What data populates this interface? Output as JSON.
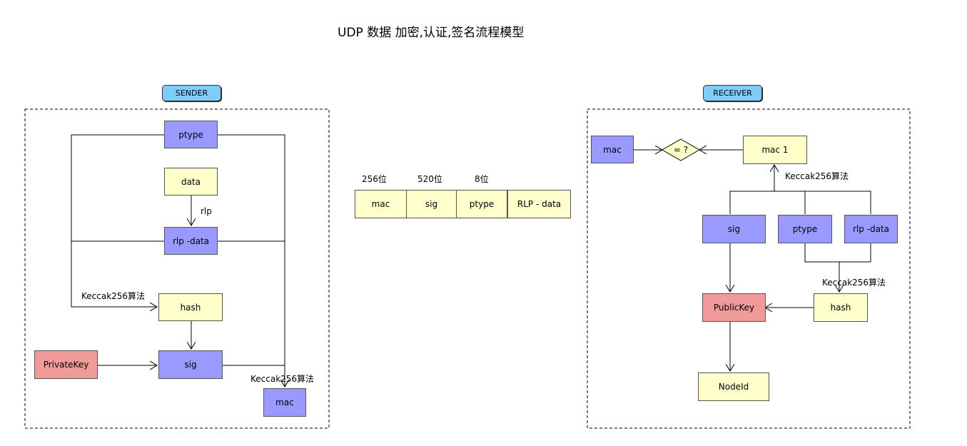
{
  "title": "UDP 数据 加密,认证,签名流程模型",
  "sender": {
    "label": "SENDER",
    "ptype": "ptype",
    "data": "data",
    "rlp_label": "rlp",
    "rlp_data": "rlp -data",
    "keccak_label": "Keccak256算法",
    "hash": "hash",
    "private_key": "PrivateKey",
    "sig": "sig",
    "keccak_label_2": "Keccak256算法",
    "mac": "mac"
  },
  "packet": {
    "bits": [
      "256位",
      "520位",
      "8位"
    ],
    "fields": [
      "mac",
      "sig",
      "ptype",
      "RLP - data"
    ]
  },
  "receiver": {
    "label": "RECEIVER",
    "mac": "mac",
    "compare": "= ?",
    "mac1": "mac 1",
    "keccak_label": "Keccak256算法",
    "sig": "sig",
    "ptype": "ptype",
    "rlp_data": "rlp -data",
    "keccak_label_2": "Keccak256算法",
    "public_key": "PublicKey",
    "hash": "hash",
    "node_id": "NodeId"
  },
  "colors": {
    "blue_node": "#9999ff",
    "yellow_node": "#ffffcc",
    "red_node": "#f19a9a",
    "pill": "#7ccdf7"
  }
}
